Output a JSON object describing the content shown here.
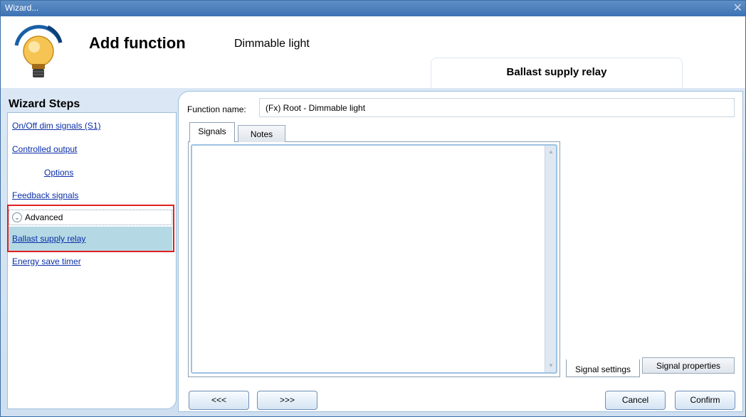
{
  "window": {
    "title": "Wizard..."
  },
  "header": {
    "title": "Add function",
    "subtitle": "Dimmable light",
    "current_step_tab": "Ballast supply relay",
    "icon": "light-bulb-icon"
  },
  "wizard_steps": {
    "title": "Wizard Steps",
    "items": [
      {
        "label": "On/Off dim signals (S1)"
      },
      {
        "label": "Controlled output"
      },
      {
        "label": "Options"
      },
      {
        "label": "Feedback signals"
      },
      {
        "label": "Ballast supply relay",
        "selected": true
      },
      {
        "label": "Energy save timer"
      }
    ],
    "advanced_label": "Advanced",
    "highlight_color": "#e02020"
  },
  "main": {
    "function_name_label": "Function name:",
    "function_name_value": "(Fx) Root - Dimmable light",
    "tabs": [
      {
        "label": "Signals",
        "active": true
      },
      {
        "label": "Notes",
        "active": false
      }
    ],
    "bottom_tabs": [
      {
        "label": "Signal settings",
        "active": true
      },
      {
        "label": "Signal properties",
        "active": false
      }
    ]
  },
  "footer": {
    "back_label": "<<<",
    "next_label": ">>>",
    "cancel_label": "Cancel",
    "confirm_label": "Confirm"
  }
}
